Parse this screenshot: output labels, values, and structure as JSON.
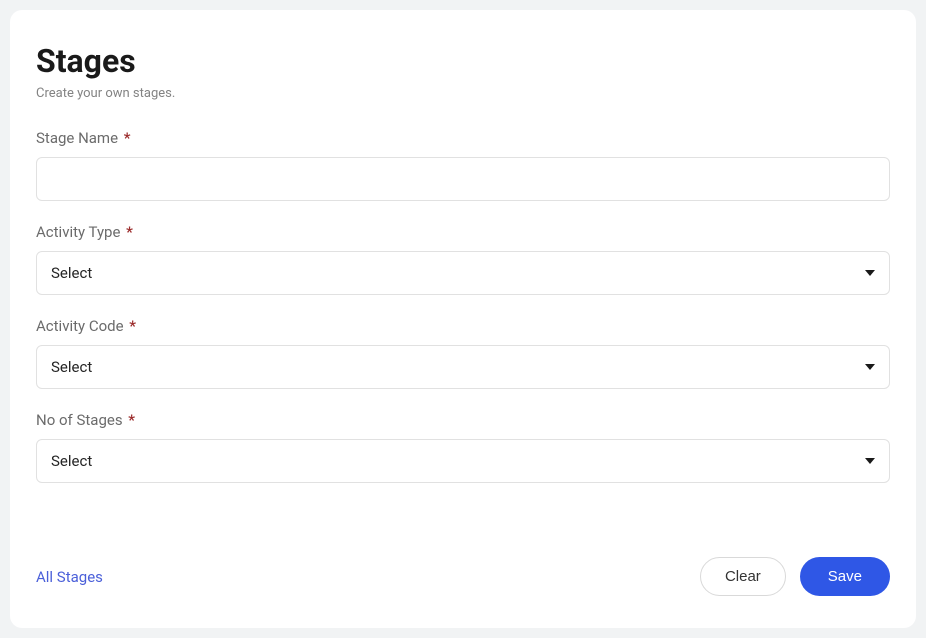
{
  "header": {
    "title": "Stages",
    "subtitle": "Create your own stages."
  },
  "fields": {
    "stage_name": {
      "label": "Stage Name",
      "value": ""
    },
    "activity_type": {
      "label": "Activity Type",
      "selected": "Select"
    },
    "activity_code": {
      "label": "Activity Code",
      "selected": "Select"
    },
    "no_of_stages": {
      "label": "No of Stages",
      "selected": "Select"
    }
  },
  "required_marker": "*",
  "footer": {
    "link": "All Stages",
    "clear": "Clear",
    "save": "Save"
  }
}
